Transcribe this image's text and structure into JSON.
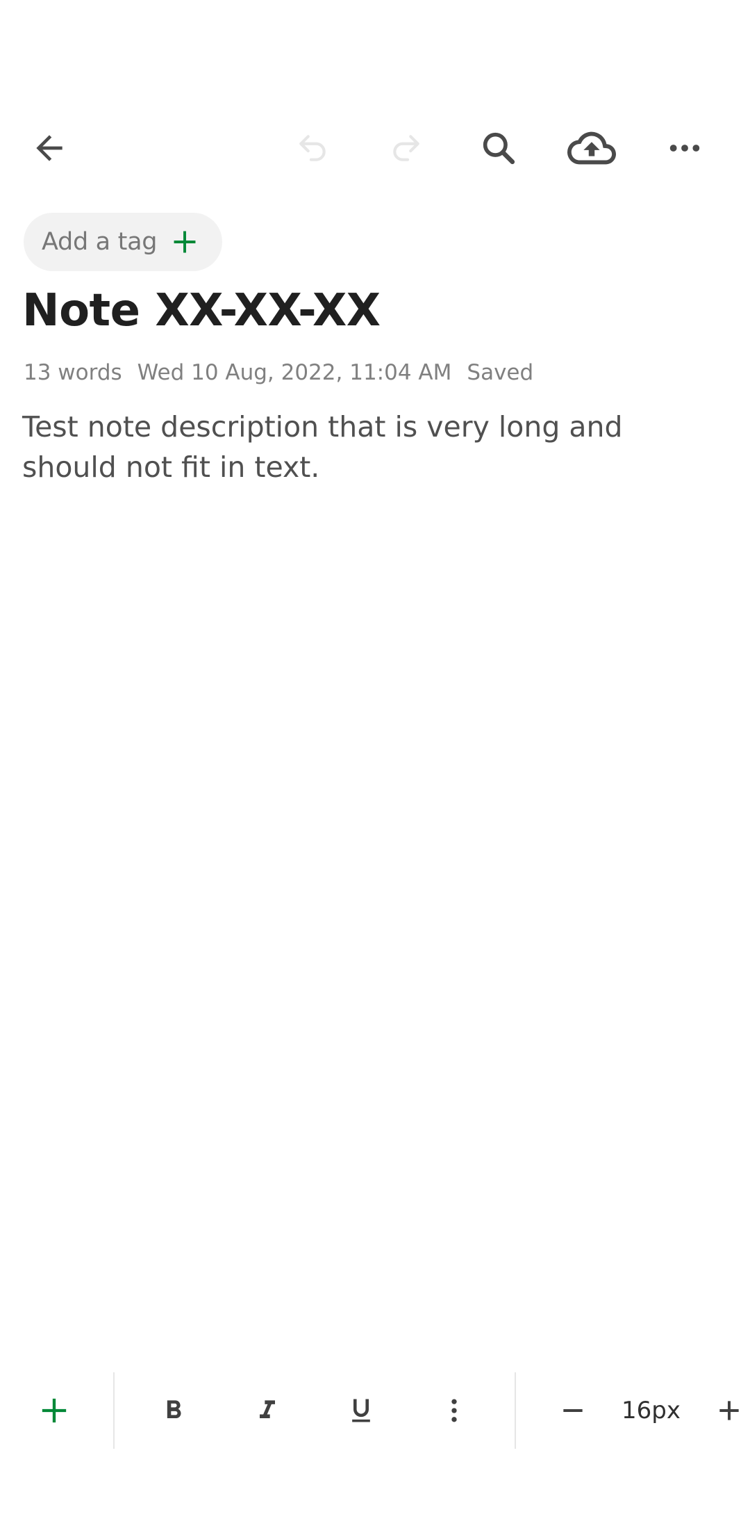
{
  "topbar": {
    "icons": {
      "back": "arrow-left-icon",
      "undo": "undo-icon",
      "redo": "redo-icon",
      "search": "search-icon",
      "sync": "cloud-upload-icon",
      "more": "more-horizontal-icon"
    }
  },
  "tag": {
    "label": "Add a tag"
  },
  "note": {
    "title": "Note XX-XX-XX",
    "word_count": "13 words",
    "date": "Wed 10 Aug, 2022, 11:04 AM",
    "status": "Saved",
    "body": "Test note description that is very long and should not fit in text."
  },
  "toolbar": {
    "font_size": "16px"
  },
  "colors": {
    "accent": "#008837",
    "icon": "#4a4a4a",
    "icon_disabled": "#e6e6e6",
    "meta_text": "#808080"
  }
}
